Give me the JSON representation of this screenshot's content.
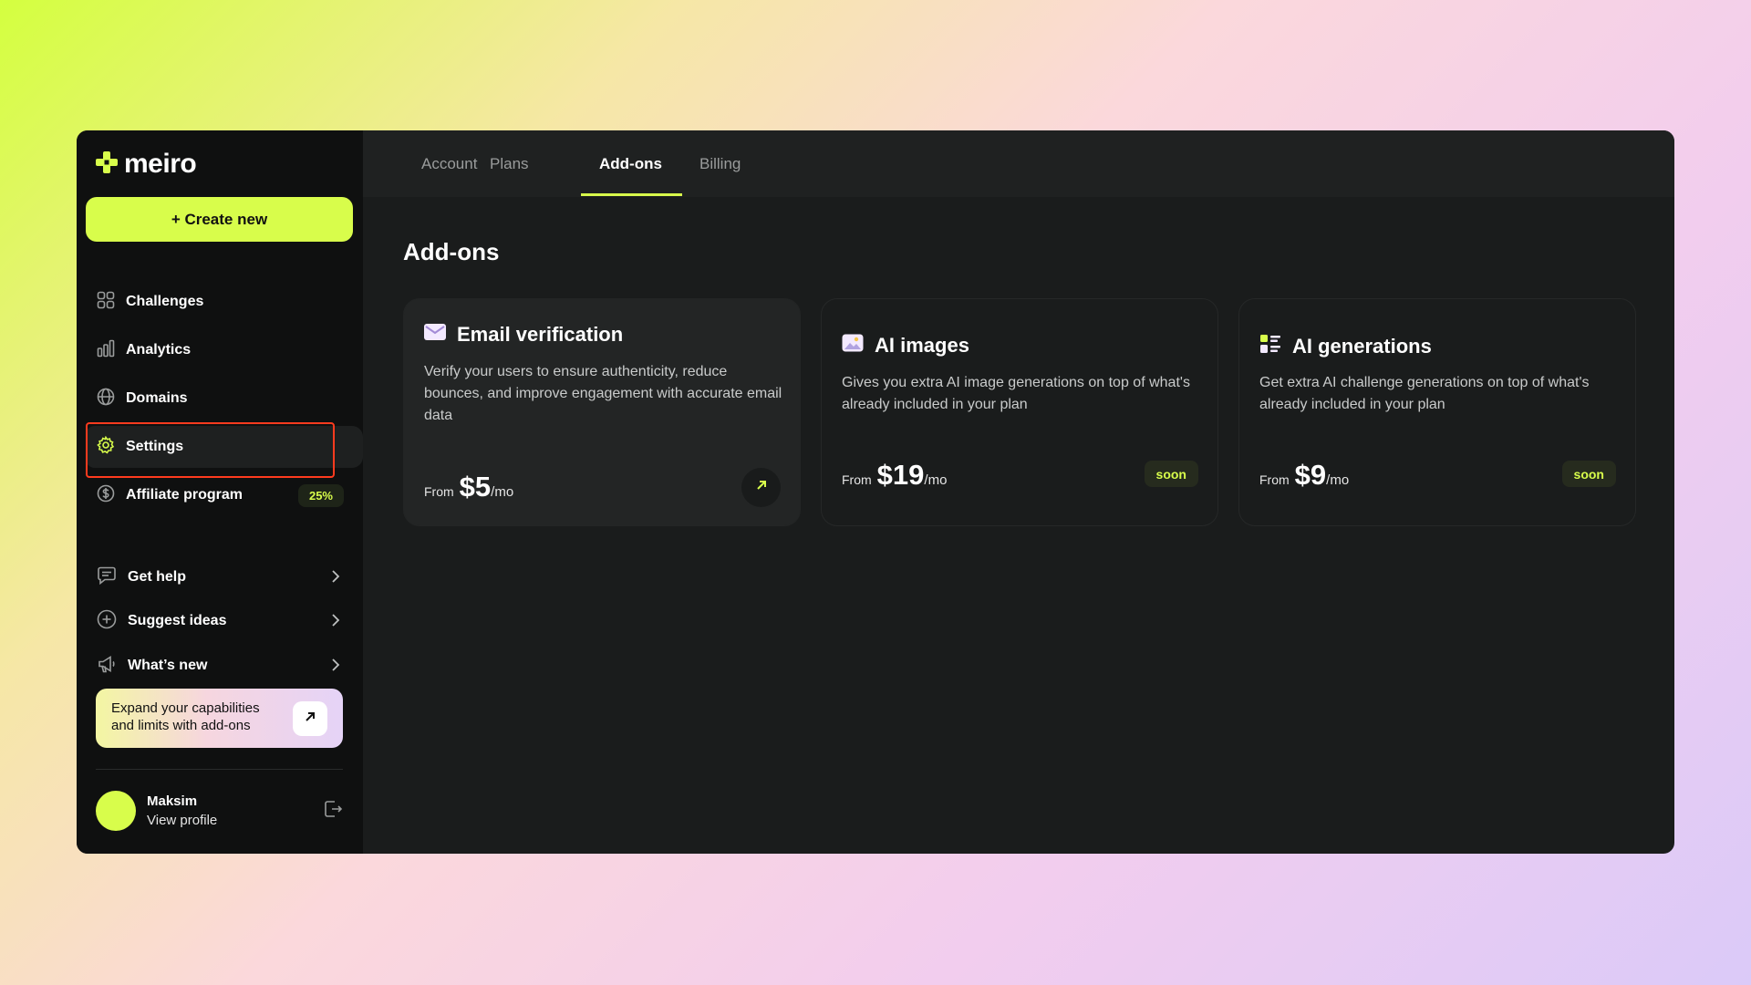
{
  "brand": {
    "name": "meiro",
    "accent": "#d8fd4b",
    "highlight": "#ff3b1e"
  },
  "sidebar": {
    "create_label": "+ Create new",
    "nav": [
      {
        "label": "Challenges",
        "icon": "grid-icon"
      },
      {
        "label": "Analytics",
        "icon": "bar-chart-icon"
      },
      {
        "label": "Domains",
        "icon": "globe-icon"
      },
      {
        "label": "Settings",
        "icon": "gear-icon",
        "active": true
      },
      {
        "label": "Affiliate program",
        "icon": "dollar-icon",
        "badge": "25%"
      }
    ],
    "secondary": [
      {
        "label": "Get help",
        "icon": "chat-icon"
      },
      {
        "label": "Suggest ideas",
        "icon": "plus-circle-icon"
      },
      {
        "label": "What’s new",
        "icon": "megaphone-icon"
      }
    ],
    "promo": {
      "line1": "Expand your capabilities",
      "line2": "and limits with add-ons"
    },
    "profile": {
      "name": "Maksim",
      "sub": "View profile"
    }
  },
  "tabs": [
    {
      "label": "Account"
    },
    {
      "label": "Plans"
    },
    {
      "label": "Add-ons",
      "active": true
    },
    {
      "label": "Billing"
    }
  ],
  "page": {
    "title": "Add-ons"
  },
  "cards": [
    {
      "title": "Email verification",
      "description": "Verify your users to ensure authenticity, reduce bounces, and improve engagement with accurate email data",
      "from": "From",
      "price": "$5",
      "per": "/mo"
    },
    {
      "title": "AI images",
      "description": "Gives you extra AI image generations on top of what's already included in your plan",
      "from": "From",
      "price": "$19",
      "per": "/mo",
      "badge": "soon"
    },
    {
      "title": "AI generations",
      "description": "Get extra AI challenge generations on top of what's already included in your plan",
      "from": "From",
      "price": "$9",
      "per": "/mo",
      "badge": "soon"
    }
  ]
}
